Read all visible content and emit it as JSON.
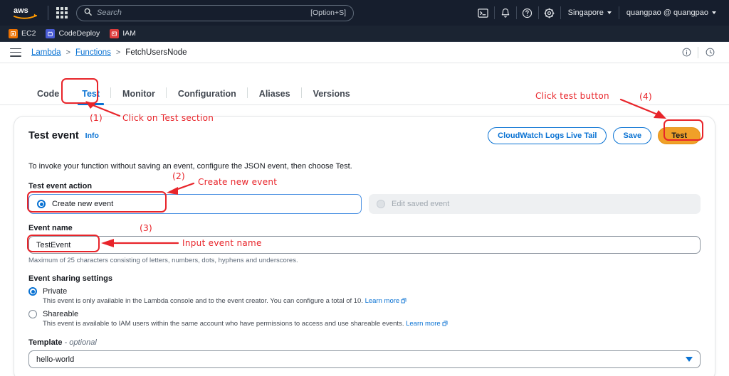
{
  "topnav": {
    "logo_alt": "aws",
    "app_grid_label": "Services",
    "search": {
      "placeholder": "Search",
      "shortcut": "[Option+S]"
    },
    "cloudshell_label": "CloudShell",
    "notifications_label": "Notifications",
    "help_label": "Help",
    "settings_label": "Settings",
    "region": "Singapore",
    "account": "quangpao @ quangpao"
  },
  "favorites": [
    {
      "label": "EC2",
      "color": "#ed7100"
    },
    {
      "label": "CodeDeploy",
      "color": "#4a5cd4"
    },
    {
      "label": "IAM",
      "color": "#dd3b3b"
    }
  ],
  "breadcrumb": {
    "items": [
      {
        "label": "Lambda",
        "link": true
      },
      {
        "label": "Functions",
        "link": true
      },
      {
        "label": "FetchUsersNode",
        "link": false
      }
    ],
    "separator": ">",
    "info_icon": "info-circle-icon",
    "history_icon": "clock-icon"
  },
  "tabs": [
    {
      "label": "Code",
      "active": false
    },
    {
      "label": "Test",
      "active": true
    },
    {
      "label": "Monitor",
      "active": false
    },
    {
      "label": "Configuration",
      "active": false
    },
    {
      "label": "Aliases",
      "active": false
    },
    {
      "label": "Versions",
      "active": false
    }
  ],
  "card": {
    "title": "Test event",
    "info_label": "Info",
    "buttons": {
      "cloudwatch": "CloudWatch Logs Live Tail",
      "save": "Save",
      "test": "Test"
    },
    "description": "To invoke your function without saving an event, configure the JSON event, then choose Test.",
    "test_event_action": {
      "label": "Test event action",
      "options": [
        {
          "label": "Create new event",
          "selected": true,
          "disabled": false
        },
        {
          "label": "Edit saved event",
          "selected": false,
          "disabled": true
        }
      ]
    },
    "event_name": {
      "label": "Event name",
      "value": "TestEvent",
      "placeholder": "Event name",
      "hint": "Maximum of 25 characters consisting of letters, numbers, dots, hyphens and underscores."
    },
    "event_sharing": {
      "label": "Event sharing settings",
      "options": [
        {
          "label": "Private",
          "selected": true,
          "description": "This event is only available in the Lambda console and to the event creator. You can configure a total of 10.",
          "learn_more": "Learn more"
        },
        {
          "label": "Shareable",
          "selected": false,
          "description": "This event is available to IAM users within the same account who have permissions to access and use shareable events.",
          "learn_more": "Learn more"
        }
      ]
    },
    "template": {
      "label": "Template",
      "optional_suffix": "- optional",
      "value": "hello-world"
    }
  },
  "annotations": {
    "color": "#e8242a",
    "items": [
      {
        "number": "(1)",
        "text": "Click on Test section"
      },
      {
        "number": "(2)",
        "text": "Create new event"
      },
      {
        "number": "(3)",
        "text": "Input event name"
      },
      {
        "number": "(4)",
        "text": "Click test button"
      }
    ]
  }
}
